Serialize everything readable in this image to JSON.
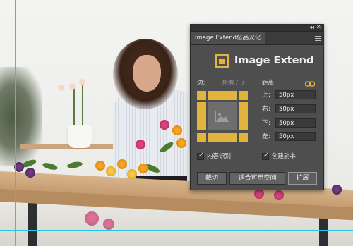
{
  "panel": {
    "tab_title": "Image Extend亿品汉化",
    "window_controls": {
      "collapse_icon": "double-chevron-icon",
      "close_icon": "close-icon",
      "menu_icon": "hamburger-menu-icon"
    },
    "brand": {
      "title": "Image Extend",
      "logo_color": "#e3b43d"
    },
    "edges": {
      "label": "边:",
      "options": [
        "所有",
        "无"
      ],
      "separator": "/"
    },
    "distance": {
      "label": "距离:",
      "link_icon": "link-chain-icon",
      "fields": [
        {
          "label": "上:",
          "value": "50px"
        },
        {
          "label": "右:",
          "value": "50px"
        },
        {
          "label": "下:",
          "value": "50px"
        },
        {
          "label": "左:",
          "value": "50px"
        }
      ]
    },
    "checkboxes": [
      {
        "label": "内容识别",
        "checked": true
      },
      {
        "label": "创建副本",
        "checked": true
      }
    ],
    "buttons": {
      "crop": "裁切",
      "fit": "适合可用空间",
      "extend": "扩展"
    },
    "colors": {
      "panel_bg": "#4e4e4e",
      "accent": "#e3b43d"
    }
  }
}
